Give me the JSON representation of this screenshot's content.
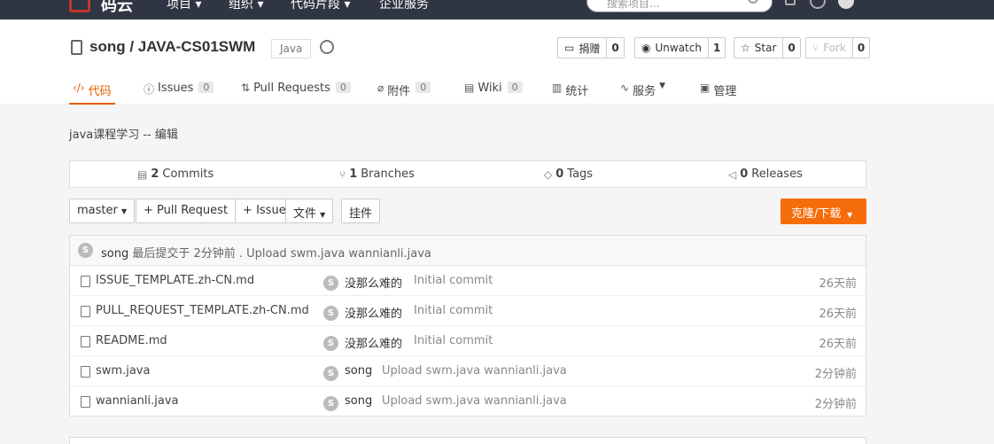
{
  "topnav": {
    "brand": "码云",
    "items": [
      "项目",
      "组织",
      "代码片段",
      "企业服务"
    ],
    "search_placeholder": "搜索项目...",
    "user_initial": "S"
  },
  "repo": {
    "title": "song / JAVA-CS01SWM",
    "lang": "Java",
    "description": "java课程学习 -- 编辑"
  },
  "header_buttons": {
    "donate": {
      "label": "捐赠",
      "count": "0"
    },
    "unwatch": {
      "label": "Unwatch",
      "count": "1"
    },
    "star": {
      "label": "Star",
      "count": "0"
    },
    "fork": {
      "label": "Fork",
      "count": "0"
    }
  },
  "tabs": [
    {
      "label": "代码",
      "icon": "code-icon"
    },
    {
      "label": "Issues",
      "count": "0",
      "icon": "issue-icon"
    },
    {
      "label": "Pull Requests",
      "count": "0",
      "icon": "pull-request-icon"
    },
    {
      "label": "附件",
      "count": "0",
      "icon": "attachment-icon"
    },
    {
      "label": "Wiki",
      "count": "0",
      "icon": "wiki-icon"
    },
    {
      "label": "统计",
      "icon": "chart-icon"
    },
    {
      "label": "服务",
      "icon": "service-icon"
    },
    {
      "label": "管理",
      "icon": "manage-icon"
    }
  ],
  "stats": {
    "commits": {
      "num": "2",
      "label": "Commits"
    },
    "branches": {
      "num": "1",
      "label": "Branches"
    },
    "tags": {
      "num": "0",
      "label": "Tags"
    },
    "releases": {
      "num": "0",
      "label": "Releases"
    }
  },
  "toolbar": {
    "branch": "master",
    "pull_request": "+ Pull Request",
    "issue": "+ Issue",
    "files": "文件",
    "widget": "挂件",
    "clone": "克隆/下载"
  },
  "last_commit": {
    "avatar": "S",
    "author": "song",
    "text": "最后提交于 2分钟前 . Upload swm.java wannianli.java"
  },
  "files": [
    {
      "name": "ISSUE_TEMPLATE.zh-CN.md",
      "author": "没那么难的",
      "message": "Initial commit",
      "time": "26天前"
    },
    {
      "name": "PULL_REQUEST_TEMPLATE.zh-CN.md",
      "author": "没那么难的",
      "message": "Initial commit",
      "time": "26天前"
    },
    {
      "name": "README.md",
      "author": "没那么难的",
      "message": "Initial commit",
      "time": "26天前"
    },
    {
      "name": "swm.java",
      "author": "song",
      "message": "Upload swm.java wannianli.java",
      "time": "2分钟前"
    },
    {
      "name": "wannianli.java",
      "author": "song",
      "message": "Upload swm.java wannianli.java",
      "time": "2分钟前"
    }
  ],
  "colors": {
    "accent": "#f56c0a",
    "topnav": "#2f3542"
  }
}
